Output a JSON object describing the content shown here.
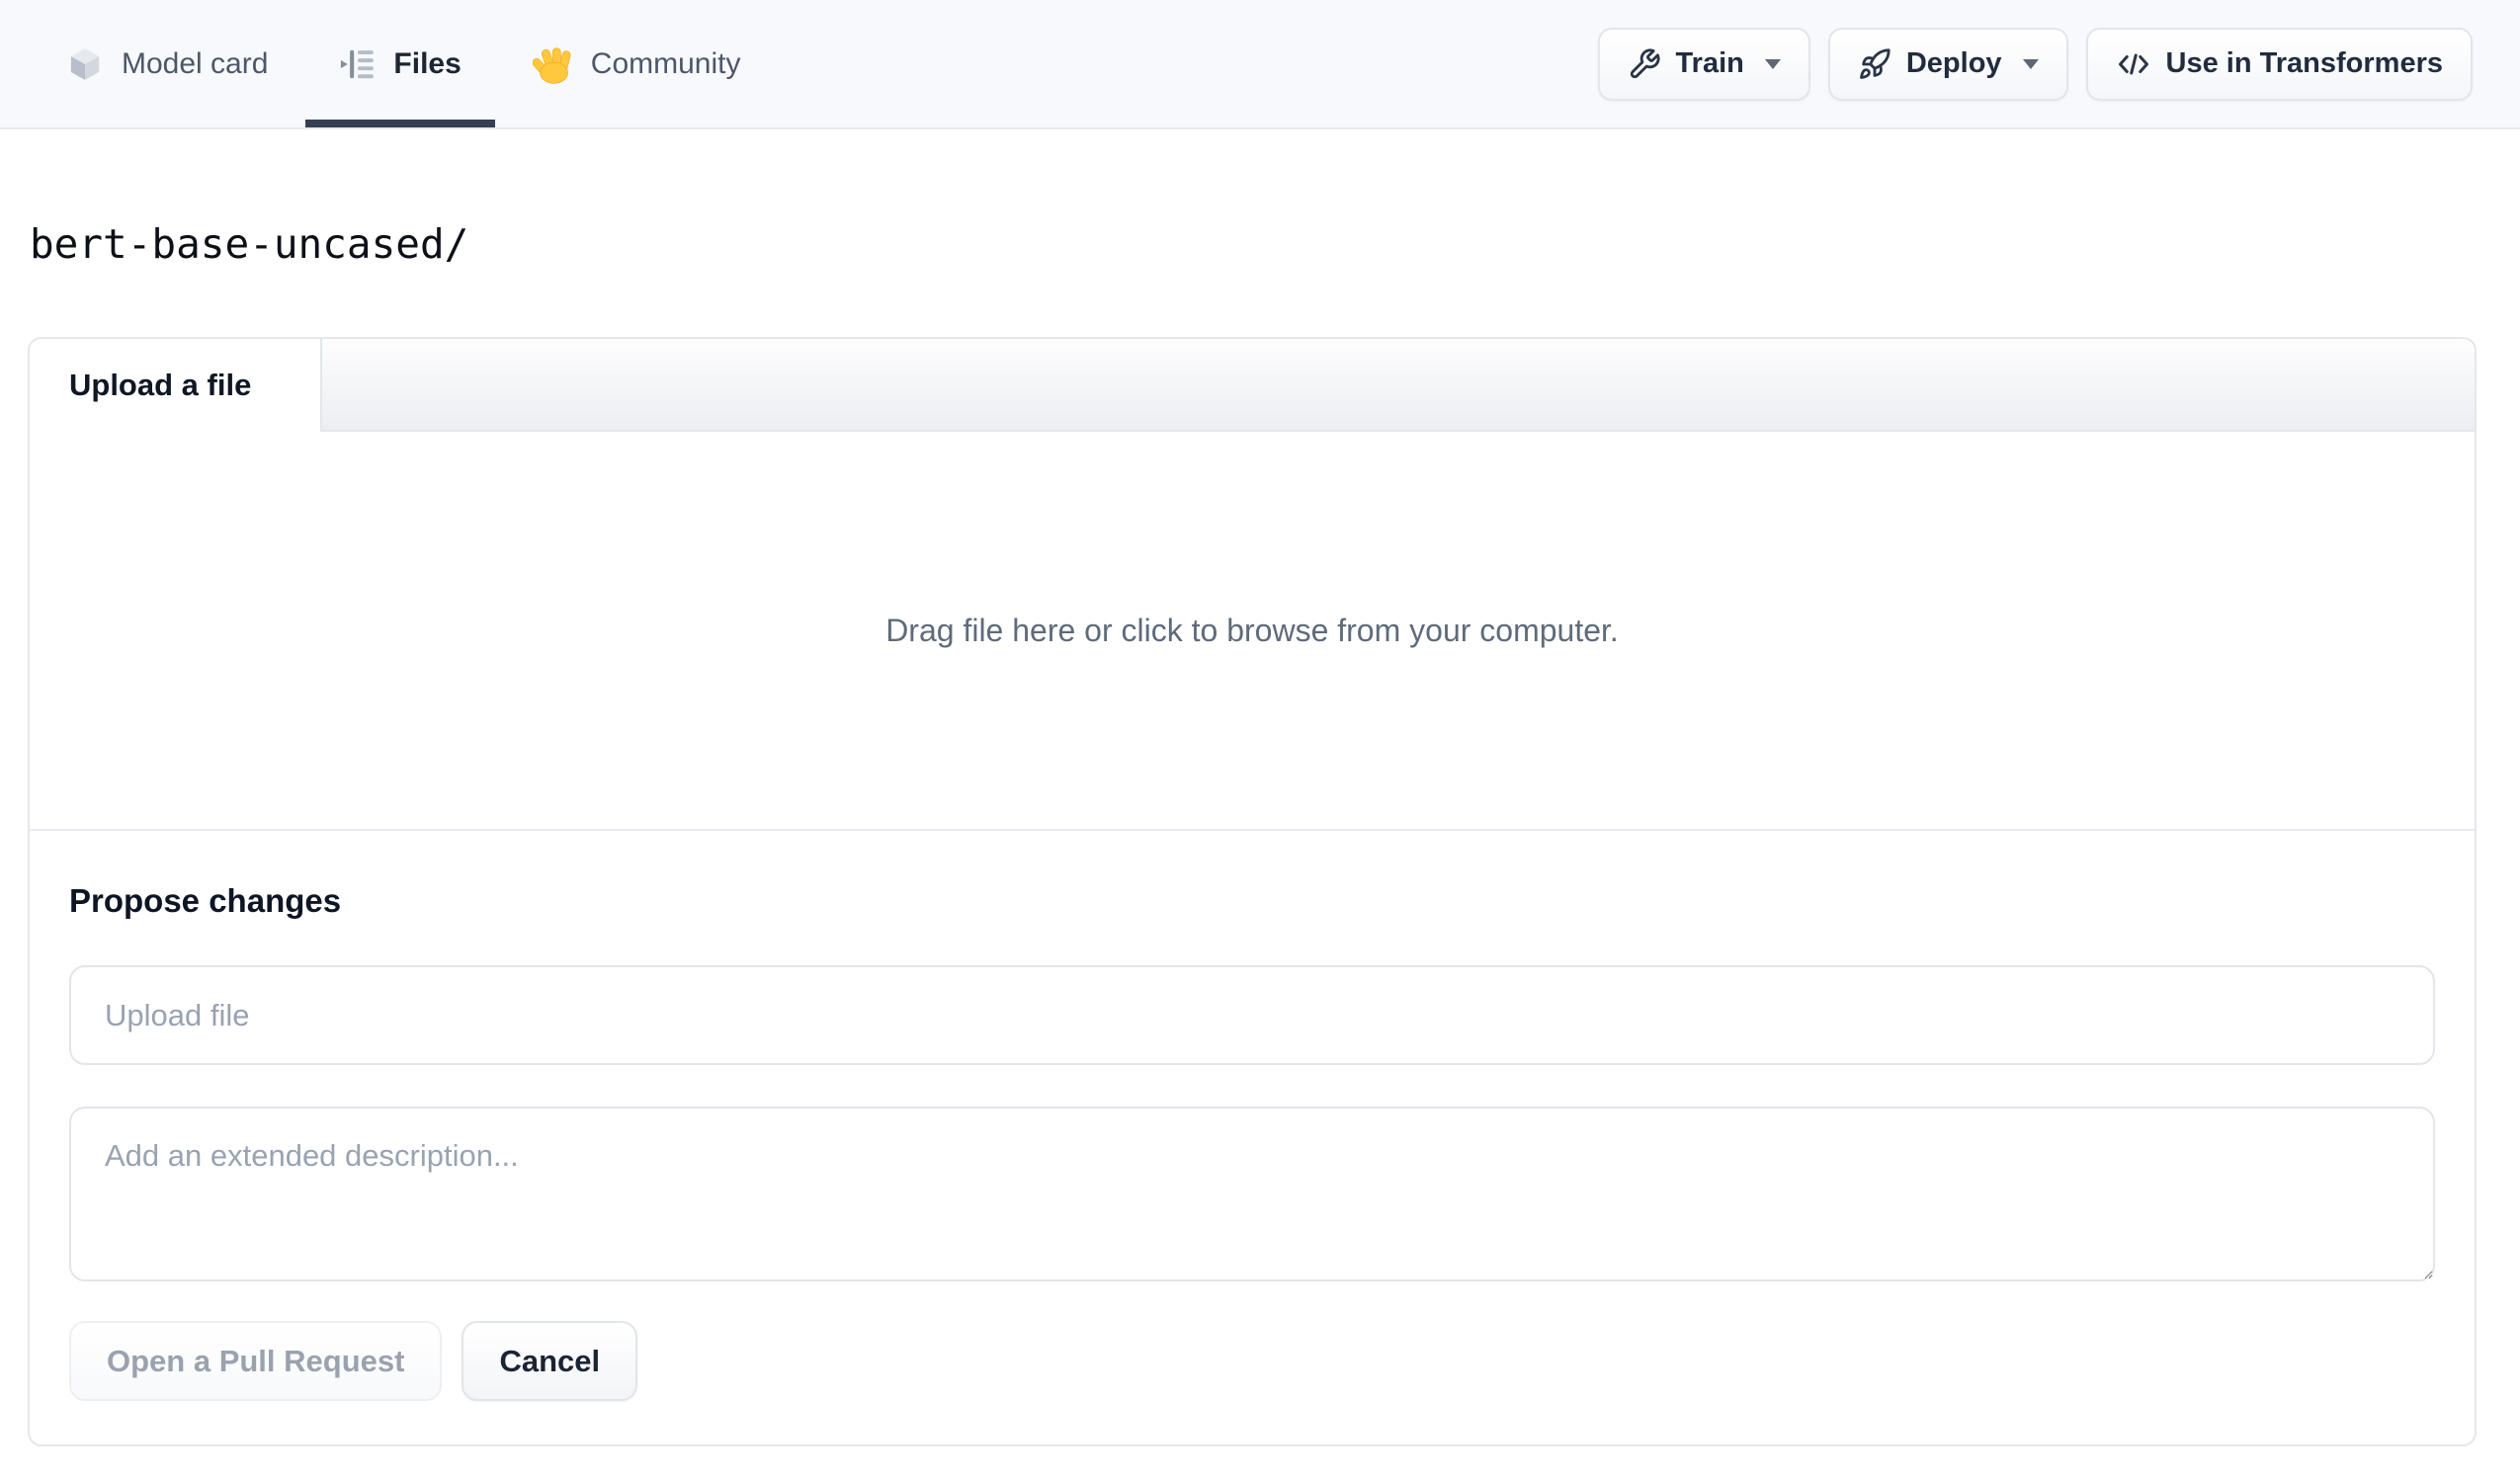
{
  "nav": {
    "tabs": [
      {
        "label": "Model card",
        "icon": "cube-icon",
        "active": false
      },
      {
        "label": "Files",
        "icon": "files-icon",
        "active": true
      },
      {
        "label": "Community",
        "icon": "wave-icon",
        "active": false
      }
    ],
    "actions": [
      {
        "label": "Train",
        "icon": "wrench-icon",
        "has_caret": true
      },
      {
        "label": "Deploy",
        "icon": "rocket-icon",
        "has_caret": true
      },
      {
        "label": "Use in Transformers",
        "icon": "code-icon",
        "has_caret": false
      }
    ]
  },
  "breadcrumb": {
    "path": "bert-base-uncased/"
  },
  "upload_panel": {
    "tab_label": "Upload a file",
    "dropzone_text": "Drag file here or click to browse from your computer.",
    "propose_heading": "Propose changes",
    "filename_placeholder": "Upload file",
    "description_placeholder": "Add an extended description...",
    "submit_label": "Open a Pull Request",
    "cancel_label": "Cancel"
  },
  "colors": {
    "nav_background": "#f8f9fc",
    "active_underline": "#353e52",
    "panel_border": "#e5e7eb",
    "muted_text": "#5f6b7a",
    "disabled_text": "#9aa2ae",
    "dark_text": "#1b2433",
    "wave_yellow": "#ffc83d"
  }
}
